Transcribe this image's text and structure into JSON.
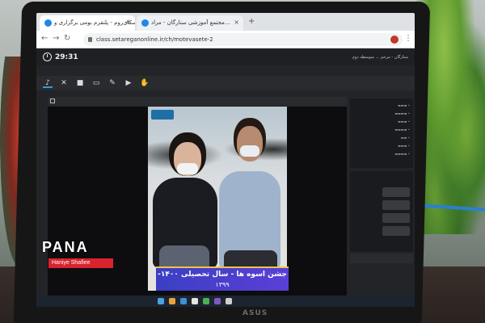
{
  "browser": {
    "tabs": [
      {
        "label": "اسکای‌روم - پلتفرم بومی برگزاری و..."
      },
      {
        "label": "مجتمع آموزشی ستارگان - مراد..."
      }
    ],
    "url": "class.setareganonline.ir/ch/motevasete-2"
  },
  "app": {
    "timer": "29:31",
    "class_title": "ستارگان - مرحم ... متوسطه دوم"
  },
  "video": {
    "banner_line1": "جشن اسوه ها - سال تحصیلی ۱۴۰۰-",
    "banner_line2": "۱۳۹۹"
  },
  "laptop": {
    "brand": "ASUS"
  },
  "watermark": {
    "logo": "PANA",
    "credit": "Haniye Shafiee"
  },
  "colors": {
    "app_bg": "#232427",
    "accent": "#2e9be6",
    "banner": "#3b3fc4",
    "watermark_red": "#d9232e"
  }
}
